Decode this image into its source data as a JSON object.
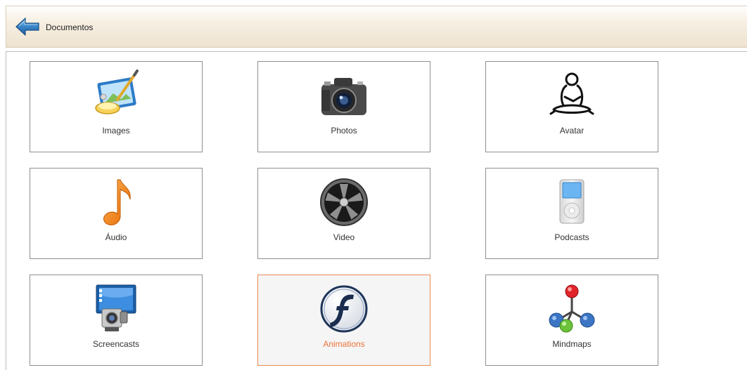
{
  "header": {
    "title": "Documentos",
    "back_icon": "back-arrow-icon"
  },
  "tiles": [
    {
      "label": "Images",
      "icon": "image-editor-icon"
    },
    {
      "label": "Photos",
      "icon": "camera-icon"
    },
    {
      "label": "Avatar",
      "icon": "avatar-icon"
    },
    {
      "label": "Áudio",
      "icon": "music-note-icon"
    },
    {
      "label": "Video",
      "icon": "film-reel-icon"
    },
    {
      "label": "Podcasts",
      "icon": "ipod-icon"
    },
    {
      "label": "Screencasts",
      "icon": "screencast-camera-icon"
    },
    {
      "label": "Animations",
      "icon": "flash-icon",
      "selected": true
    },
    {
      "label": "Mindmaps",
      "icon": "mindmap-icon"
    }
  ],
  "colors": {
    "selected_border": "#e98a4c",
    "selected_label": "#e8743a",
    "tile_border": "#8f8f8f",
    "back_arrow": "#3a86c8"
  }
}
